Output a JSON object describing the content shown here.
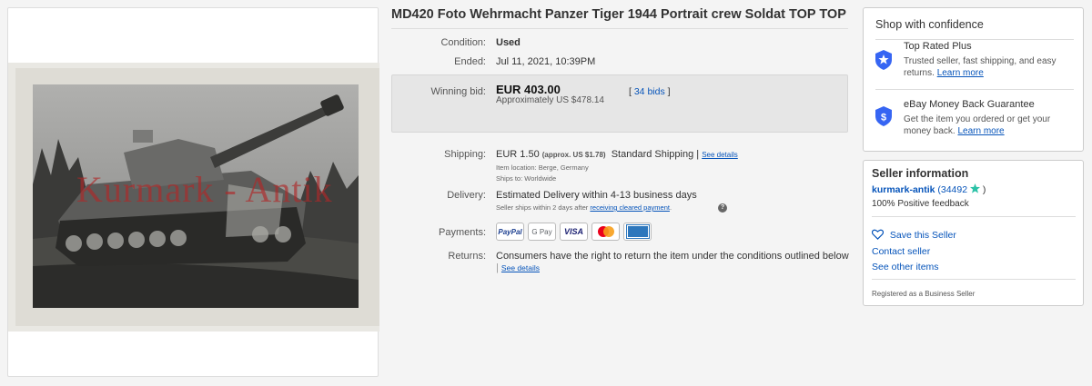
{
  "item": {
    "title": "MD420 Foto Wehrmacht Panzer Tiger 1944 Portrait crew Soldat TOP TOP",
    "watermark": "Kurmark - Antik",
    "condition_label": "Condition:",
    "condition_value": "Used",
    "ended_label": "Ended:",
    "ended_value": "Jul 11, 2021, 10:39PM",
    "bid_label": "Winning bid:",
    "bid_price": "EUR 403.00",
    "bid_approx": "Approximately US $478.14",
    "bid_count_open": "[",
    "bid_count_link": "34 bids",
    "bid_count_close": "]",
    "shipping_label": "Shipping:",
    "shipping_price": "EUR 1.50",
    "shipping_approx": "(approx. US $1.78)",
    "shipping_method": "Standard Shipping |",
    "shipping_see_details": "See details",
    "item_location": "Item location:  Berge, Germany",
    "ships_to": "Ships to:   Worldwide",
    "delivery_label": "Delivery:",
    "delivery_value": "Estimated Delivery within 4-13 business days",
    "delivery_note": "Seller ships within 2 days after",
    "delivery_link": "receiving cleared payment",
    "delivery_end": ".",
    "payments_label": "Payments:",
    "payment_methods": [
      "PayPal",
      "G Pay",
      "VISA",
      "Mastercard",
      "AMEX"
    ],
    "returns_label": "Returns:",
    "returns_value": "Consumers have the right to return the item under the conditions outlined below",
    "returns_pipe": "|",
    "returns_see_details": "See details"
  },
  "confidence": {
    "heading": "Shop with confidence",
    "top_rated_title": "Top Rated Plus",
    "top_rated_desc": "Trusted seller, fast shipping, and easy returns.",
    "top_rated_link": "Learn more",
    "guarantee_title": "eBay Money Back Guarantee",
    "guarantee_desc": "Get the item you ordered or get your money back.",
    "guarantee_link": "Learn more"
  },
  "seller": {
    "heading": "Seller information",
    "name": "kurmark-antik",
    "feedback_open": "(34492",
    "feedback_close": ")",
    "positive": "100% Positive feedback",
    "save_seller": "Save this Seller",
    "contact": "Contact seller",
    "other_items": "See other items",
    "business": "Registered as a Business Seller"
  },
  "colors": {
    "link": "#0654ba",
    "accent": "#3665f3",
    "star": "#2bc2a7"
  },
  "icons": [
    "shield-check-icon",
    "shield-dollar-icon",
    "heart-icon",
    "star-icon",
    "help-icon"
  ]
}
